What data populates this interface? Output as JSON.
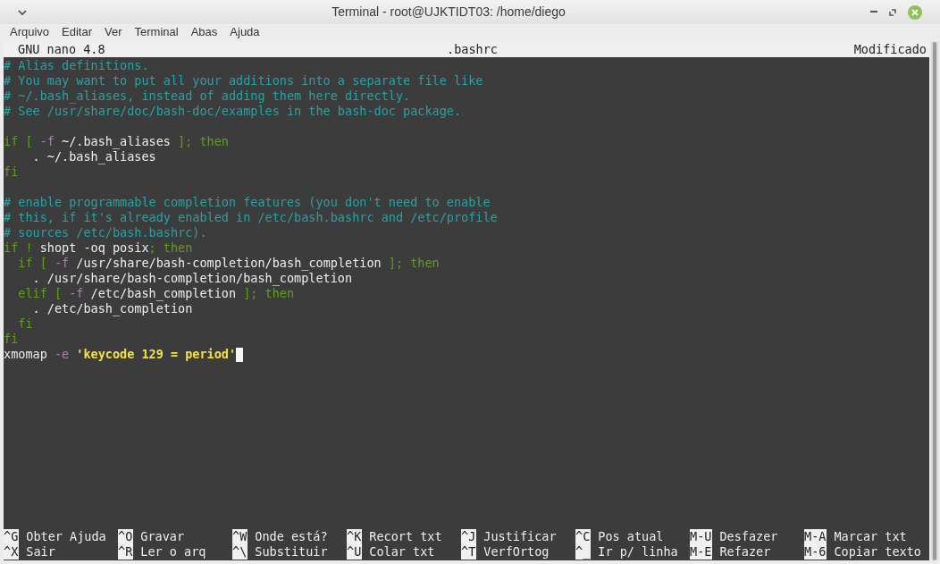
{
  "window": {
    "title": "Terminal - root@UJKTIDT03: /home/diego"
  },
  "menu": [
    "Arquivo",
    "Editar",
    "Ver",
    "Terminal",
    "Abas",
    "Ajuda"
  ],
  "nano_header": {
    "version": "GNU nano 4.8",
    "filename": ".bashrc",
    "status": "Modificado"
  },
  "editor": {
    "lines": [
      {
        "kind": "code",
        "segments": [
          {
            "text": "# Alias definitions.",
            "kind": "comment"
          }
        ]
      },
      {
        "kind": "code",
        "segments": [
          {
            "text": "# You may want to put all your additions into a separate file like",
            "kind": "comment"
          }
        ]
      },
      {
        "kind": "code",
        "segments": [
          {
            "text": "# ~/.bash_aliases, instead of adding them here directly.",
            "kind": "comment"
          }
        ]
      },
      {
        "kind": "code",
        "segments": [
          {
            "text": "# See /usr/share/doc/bash-doc/examples in the bash-doc package.",
            "kind": "comment"
          }
        ]
      },
      {
        "kind": "blank"
      },
      {
        "kind": "code",
        "segments": [
          {
            "text": "if [ ",
            "kind": "keyword"
          },
          {
            "text": "-f",
            "kind": "flag"
          },
          {
            "text": " ~/.bash_aliases ",
            "kind": "plain"
          },
          {
            "text": "]; then",
            "kind": "keyword"
          }
        ]
      },
      {
        "kind": "code",
        "segments": [
          {
            "text": "    . ~/.bash_aliases",
            "kind": "plain"
          }
        ]
      },
      {
        "kind": "code",
        "segments": [
          {
            "text": "fi",
            "kind": "keyword"
          }
        ]
      },
      {
        "kind": "blank"
      },
      {
        "kind": "code",
        "segments": [
          {
            "text": "# enable programmable completion features (you don't need to enable",
            "kind": "comment"
          }
        ]
      },
      {
        "kind": "code",
        "segments": [
          {
            "text": "# this, if it's already enabled in /etc/bash.bashrc and /etc/profile",
            "kind": "comment"
          }
        ]
      },
      {
        "kind": "code",
        "segments": [
          {
            "text": "# sources /etc/bash.bashrc).",
            "kind": "comment"
          }
        ]
      },
      {
        "kind": "code",
        "segments": [
          {
            "text": "if !",
            "kind": "keyword"
          },
          {
            "text": " shopt -oq posix",
            "kind": "plain"
          },
          {
            "text": "; then",
            "kind": "keyword"
          }
        ]
      },
      {
        "kind": "code",
        "segments": [
          {
            "text": "  if [ ",
            "kind": "keyword"
          },
          {
            "text": "-f",
            "kind": "flag"
          },
          {
            "text": " /usr/share/bash-completion/bash_completion ",
            "kind": "plain"
          },
          {
            "text": "]; then",
            "kind": "keyword"
          }
        ]
      },
      {
        "kind": "code",
        "segments": [
          {
            "text": "    . /usr/share/bash-completion/bash_completion",
            "kind": "plain"
          }
        ]
      },
      {
        "kind": "code",
        "segments": [
          {
            "text": "  elif [ ",
            "kind": "keyword"
          },
          {
            "text": "-f",
            "kind": "flag"
          },
          {
            "text": " /etc/bash_completion ",
            "kind": "plain"
          },
          {
            "text": "]; then",
            "kind": "keyword"
          }
        ]
      },
      {
        "kind": "code",
        "segments": [
          {
            "text": "    . /etc/bash_completion",
            "kind": "plain"
          }
        ]
      },
      {
        "kind": "code",
        "segments": [
          {
            "text": "  fi",
            "kind": "keyword"
          }
        ]
      },
      {
        "kind": "code",
        "segments": [
          {
            "text": "fi",
            "kind": "keyword"
          }
        ]
      },
      {
        "kind": "code",
        "cursor": true,
        "segments": [
          {
            "text": "xmomap ",
            "kind": "plain"
          },
          {
            "text": "-e",
            "kind": "flag"
          },
          {
            "text": " 'keycode 129 = period'",
            "kind": "string"
          }
        ]
      }
    ]
  },
  "shortcuts": [
    [
      {
        "key": "^G",
        "label": "Obter Ajuda"
      },
      {
        "key": "^O",
        "label": "Gravar"
      },
      {
        "key": "^W",
        "label": "Onde está?"
      },
      {
        "key": "^K",
        "label": "Recort txt"
      },
      {
        "key": "^J",
        "label": "Justificar"
      },
      {
        "key": "^C",
        "label": "Pos atual"
      },
      {
        "key": "M-U",
        "label": "Desfazer"
      },
      {
        "key": "M-A",
        "label": "Marcar txt"
      }
    ],
    [
      {
        "key": "^X",
        "label": "Sair"
      },
      {
        "key": "^R",
        "label": "Ler o arq"
      },
      {
        "key": "^\\",
        "label": "Substituir"
      },
      {
        "key": "^U",
        "label": "Colar txt"
      },
      {
        "key": "^T",
        "label": "VerfOrtog"
      },
      {
        "key": "^_",
        "label": "Ir p/ linha"
      },
      {
        "key": "M-E",
        "label": "Refazer"
      },
      {
        "key": "M-6",
        "label": "Copiar texto"
      }
    ]
  ]
}
